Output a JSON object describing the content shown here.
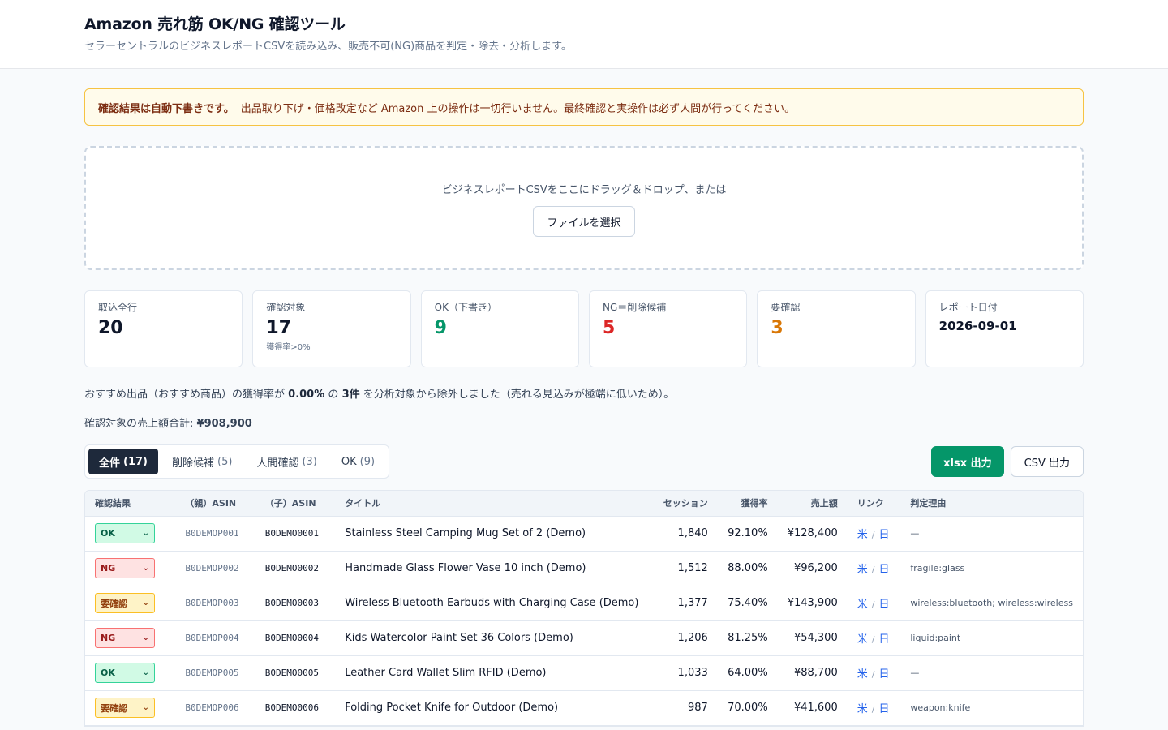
{
  "header": {
    "title": "Amazon 売れ筋 OK/NG 確認ツール",
    "subtitle": "セラーセントラルのビジネスレポートCSVを読み込み、販売不可(NG)商品を判定・除去・分析します。"
  },
  "notice": {
    "strong": "確認結果は自動下書きです。",
    "text": "出品取り下げ・価格改定など Amazon 上の操作は一切行いません。最終確認と実操作は必ず人間が行ってください。"
  },
  "dropzone": {
    "text": "ビジネスレポートCSVをここにドラッグ＆ドロップ、または",
    "button": "ファイルを選択"
  },
  "stats": {
    "total": {
      "label": "取込全行",
      "value": "20"
    },
    "target": {
      "label": "確認対象",
      "value": "17",
      "note": "獲得率>0%"
    },
    "ok": {
      "label": "OK（下書き）",
      "value": "9"
    },
    "ng": {
      "label": "NG＝削除候補",
      "value": "5"
    },
    "check": {
      "label": "要確認",
      "value": "3"
    },
    "date": {
      "label": "レポート日付",
      "value": "2026-09-01"
    }
  },
  "info": {
    "prefix": "おすすめ出品（おすすめ商品）の獲得率が",
    "rate": "0.00%",
    "mid": "の",
    "count": "3件",
    "suffix": "を分析対象から除外しました（売れる見込みが極端に低いため）。"
  },
  "total": {
    "label": "確認対象の売上額合計:",
    "value": "¥908,900"
  },
  "tabs": [
    {
      "label": "全件",
      "count": "(17)"
    },
    {
      "label": "削除候補",
      "count": "(5)"
    },
    {
      "label": "人間確認",
      "count": "(3)"
    },
    {
      "label": "OK",
      "count": "(9)"
    }
  ],
  "exports": {
    "xlsx": "xlsx 出力",
    "csv": "CSV 出力"
  },
  "table": {
    "headers": [
      "確認結果",
      "（親）ASIN",
      "（子）ASIN",
      "タイトル",
      "セッション",
      "獲得率",
      "売上額",
      "リンク",
      "判定理由"
    ],
    "link_us": "米",
    "link_sep": "/",
    "link_jp": "日",
    "rows": [
      {
        "status": "OK",
        "parent": "B0DEMOP001",
        "child": "B0DEMO0001",
        "title": "Stainless Steel Camping Mug Set of 2 (Demo)",
        "sessions": "1,840",
        "rate": "92.10%",
        "sales": "¥128,400",
        "reason": "—"
      },
      {
        "status": "NG",
        "parent": "B0DEMOP002",
        "child": "B0DEMO0002",
        "title": "Handmade Glass Flower Vase 10 inch (Demo)",
        "sessions": "1,512",
        "rate": "88.00%",
        "sales": "¥96,200",
        "reason": "fragile:glass"
      },
      {
        "status": "要確認",
        "parent": "B0DEMOP003",
        "child": "B0DEMO0003",
        "title": "Wireless Bluetooth Earbuds with Charging Case (Demo)",
        "sessions": "1,377",
        "rate": "75.40%",
        "sales": "¥143,900",
        "reason": "wireless:bluetooth; wireless:wireless"
      },
      {
        "status": "NG",
        "parent": "B0DEMOP004",
        "child": "B0DEMO0004",
        "title": "Kids Watercolor Paint Set 36 Colors (Demo)",
        "sessions": "1,206",
        "rate": "81.25%",
        "sales": "¥54,300",
        "reason": "liquid:paint"
      },
      {
        "status": "OK",
        "parent": "B0DEMOP005",
        "child": "B0DEMO0005",
        "title": "Leather Card Wallet Slim RFID (Demo)",
        "sessions": "1,033",
        "rate": "64.00%",
        "sales": "¥88,700",
        "reason": "—"
      },
      {
        "status": "要確認",
        "parent": "B0DEMOP006",
        "child": "B0DEMO0006",
        "title": "Folding Pocket Knife for Outdoor (Demo)",
        "sessions": "987",
        "rate": "70.00%",
        "sales": "¥41,600",
        "reason": "weapon:knife"
      }
    ]
  },
  "colors": {
    "ok": "#059669",
    "ng": "#dc2626",
    "check": "#d97706",
    "primary": "#1e293b"
  }
}
